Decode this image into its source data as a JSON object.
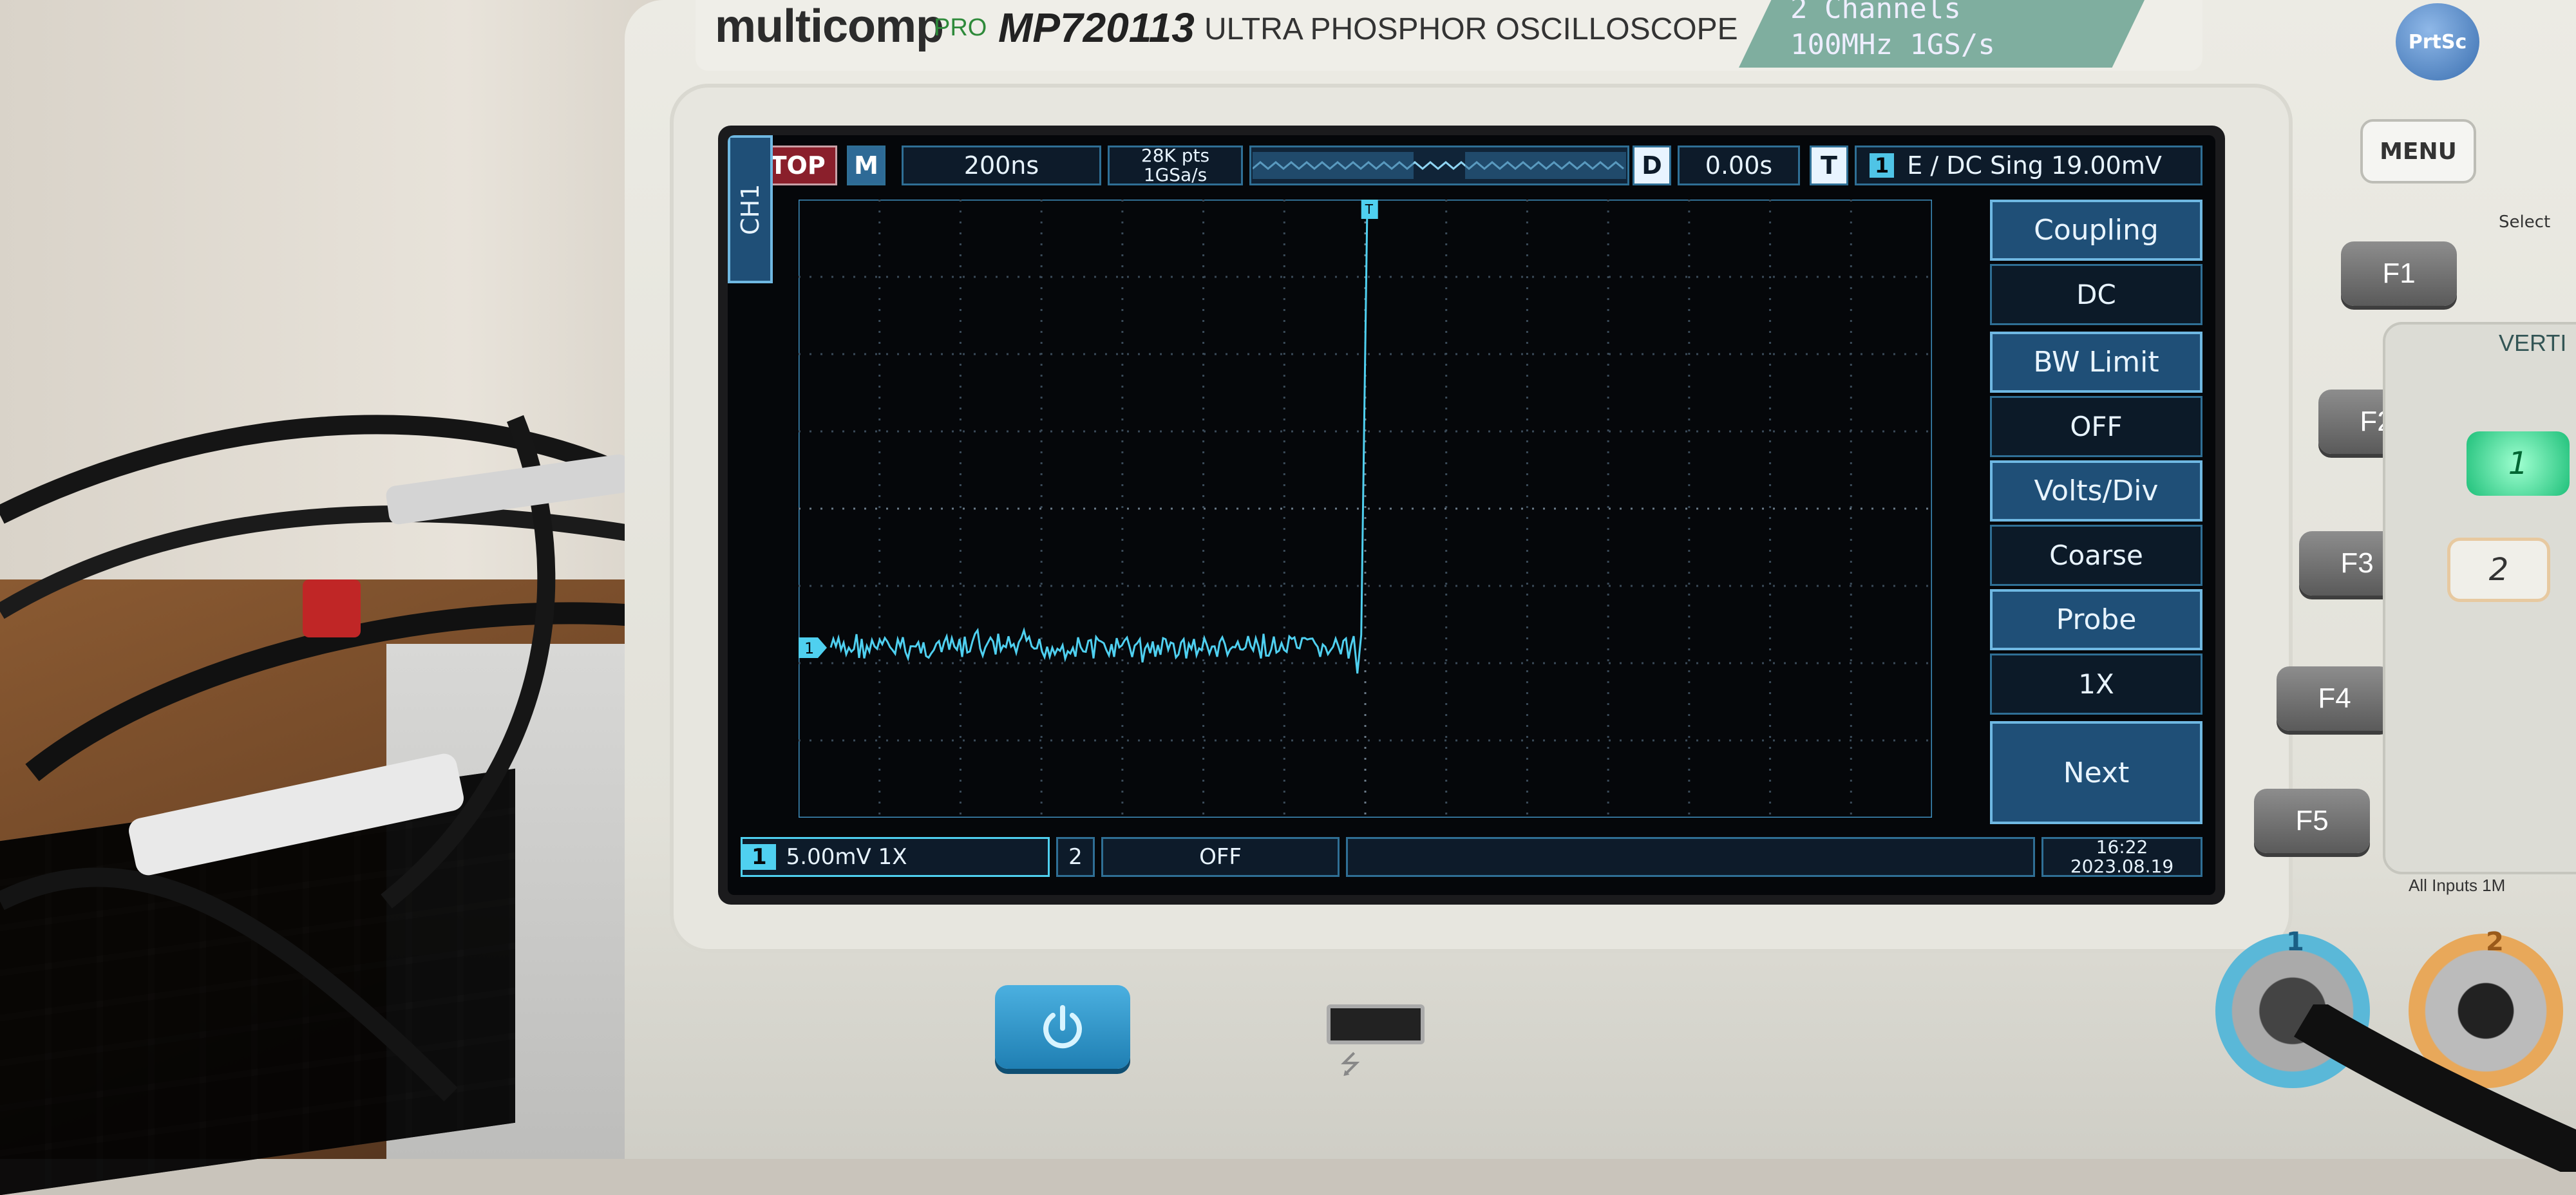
{
  "header": {
    "brand": "multicomp",
    "brand_suffix": "PRO",
    "model": "MP720113",
    "description": "ULTRA PHOSPHOR OSCILLOSCOPE",
    "channels_line1": "2 Channels",
    "channels_line2": "100MHz 1GS/s"
  },
  "status_bar": {
    "run_state": "STOP",
    "mode": "M",
    "timebase": "200ns",
    "memory_depth": "28K pts",
    "sample_rate": "1GSa/s",
    "h_label": "D",
    "h_position": "0.00s",
    "trig_label": "T",
    "trig_channel": "1",
    "trigger_info": "E ∕ DC Sing 19.00mV"
  },
  "side_menu": {
    "channel_tab": "CH1",
    "items": [
      {
        "label": "Coupling",
        "value": "DC"
      },
      {
        "label": "BW Limit",
        "value": "OFF"
      },
      {
        "label": "Volts/Div",
        "value": "Coarse"
      },
      {
        "label": "Probe",
        "value": "1X"
      }
    ],
    "next_label": "Next"
  },
  "bottom_bar": {
    "ch1_number": "1",
    "ch1_scale": "5.00mV 1X",
    "ch2_number": "2",
    "ch2_state": "OFF",
    "time": "16:22",
    "date": "2023.08.19"
  },
  "trace": {
    "channel_marker": "1",
    "trigger_marker": "T",
    "baseline_div": -1.8,
    "step_time_div": -0.05,
    "step_top_div": 5.5,
    "noise_amplitude_div": 0.15,
    "color": "#4fd0f0"
  },
  "controls": {
    "prtsc": "PrtSc",
    "menu": "MENU",
    "select": "Select",
    "fkeys": [
      "F1",
      "F2",
      "F3",
      "F4",
      "F5"
    ],
    "vertical_label": "VERTI",
    "ch1_button": "1",
    "ch2_button": "2",
    "all_inputs": "All Inputs 1M",
    "bnc1_label": "1",
    "bnc2_label": "2"
  },
  "colors": {
    "screen_bg": "#05070a",
    "accent_blue": "#6fb8e2",
    "trace": "#4fd0f0",
    "stop_red": "#8a1f2b"
  }
}
